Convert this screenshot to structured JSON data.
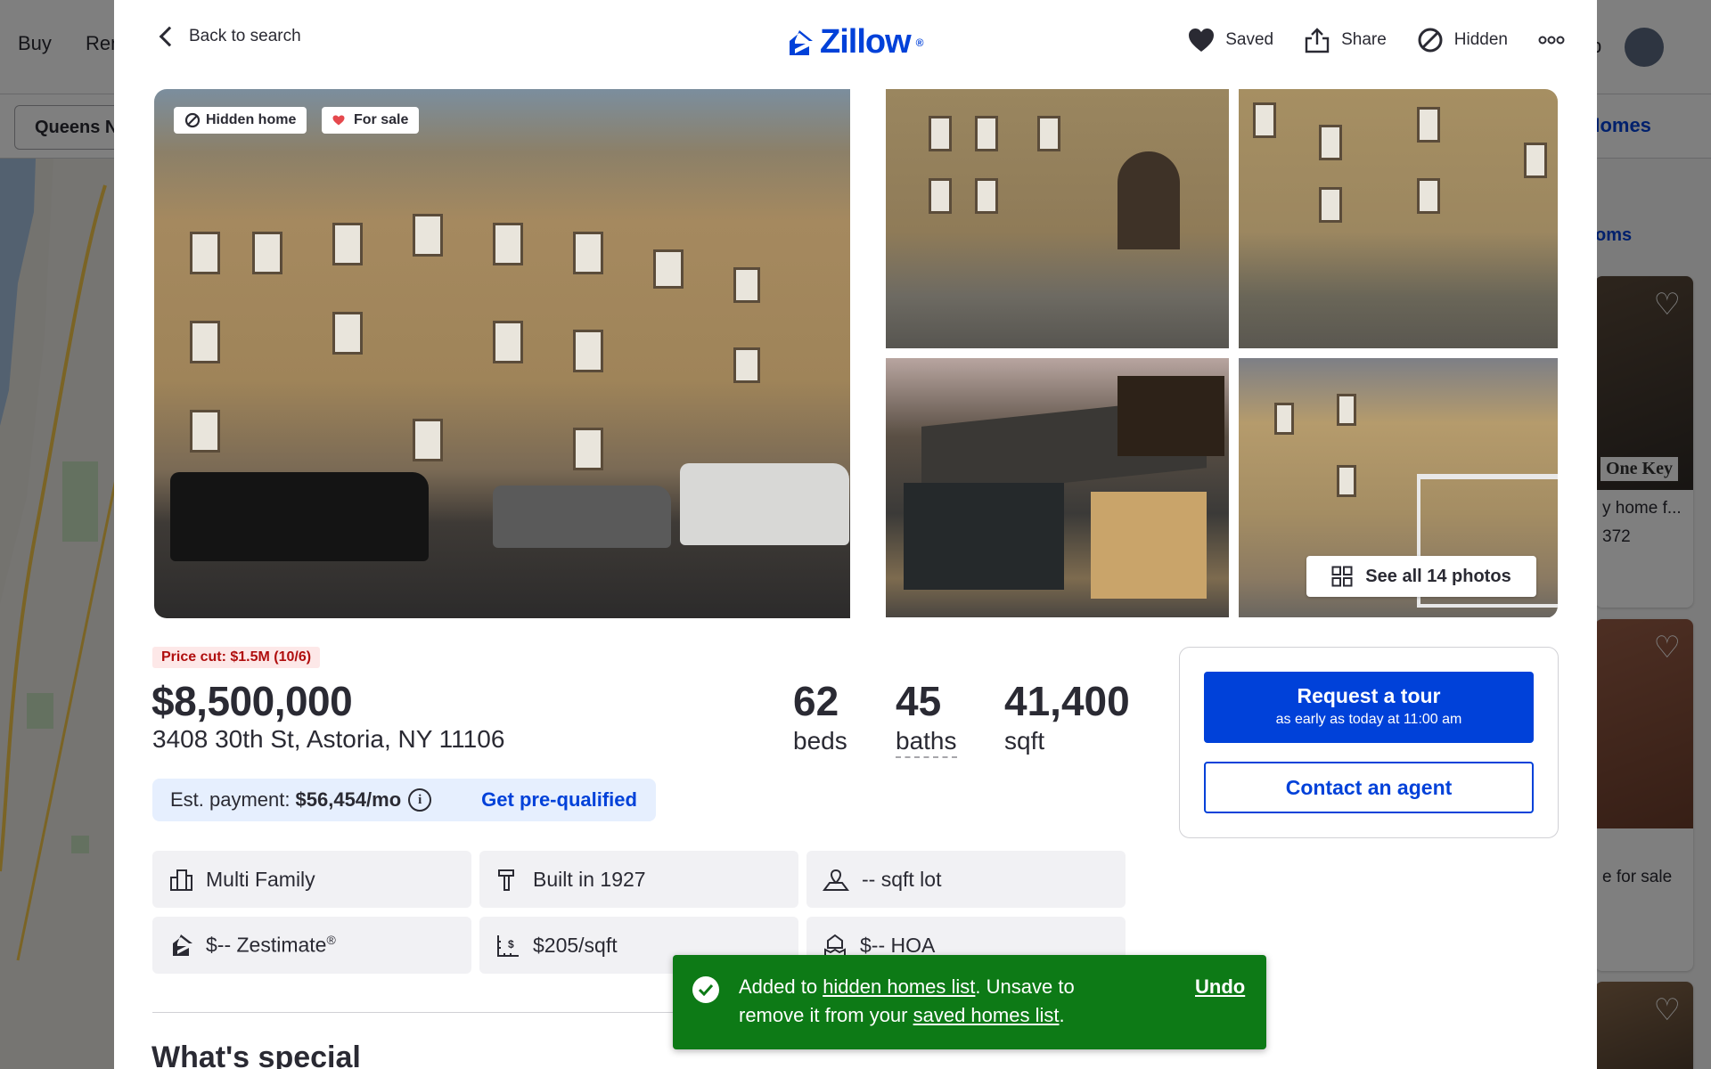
{
  "background": {
    "nav": [
      "Buy",
      "Rent"
    ],
    "help_label": "p",
    "search_value": "Queens N",
    "save_homes_label": "d Homes",
    "sort_label": "rooms",
    "cards": [
      {
        "text1": "",
        "text2": "",
        "badge": "One Key"
      },
      {
        "text1": "y home f...",
        "text2": "372",
        "badge": ""
      },
      {
        "text1": "e for sale",
        "text2": "",
        "badge": ""
      }
    ]
  },
  "modal": {
    "back_label": "Back to search",
    "logo_text": "Zillow",
    "logo_mark": "®",
    "actions": {
      "saved": "Saved",
      "share": "Share",
      "hidden": "Hidden"
    },
    "gallery": {
      "chip_hidden": "Hidden home",
      "chip_forsale": "For sale",
      "see_all": "See all 14 photos"
    },
    "listing": {
      "price_cut": "Price cut: $1.5M (10/6)",
      "price": "$8,500,000",
      "address": "3408 30th St, Astoria, NY 11106",
      "beds_num": "62",
      "beds_label": "beds",
      "baths_num": "45",
      "baths_label": "baths",
      "sqft_num": "41,400",
      "sqft_label": "sqft"
    },
    "payment": {
      "label": "Est. payment:",
      "value": "$56,454/mo",
      "prequal": "Get pre-qualified"
    },
    "facts": [
      {
        "icon": "building-icon",
        "label": "Multi Family"
      },
      {
        "icon": "hammer-icon",
        "label": "Built in 1927"
      },
      {
        "icon": "lot-icon",
        "label": "-- sqft lot"
      },
      {
        "icon": "zestimate-icon",
        "label": "$-- Zestimate",
        "sup": "®"
      },
      {
        "icon": "price-sqft-icon",
        "label": "$205/sqft"
      },
      {
        "icon": "hoa-icon",
        "label": "$-- HOA"
      }
    ],
    "section_title": "What's special",
    "contact": {
      "tour_title": "Request a tour",
      "tour_sub": "as early as today at 11:00 am",
      "agent": "Contact an agent"
    },
    "toast": {
      "part1": "Added to ",
      "link1": "hidden homes list",
      "part2": ". Unsave to remove it from your ",
      "link2": "saved homes list",
      "part3": ".",
      "undo": "Undo"
    }
  },
  "colors": {
    "brand_blue": "#0041d9",
    "toast_green": "#0d7a16",
    "price_cut_red": "#b00e0e"
  }
}
